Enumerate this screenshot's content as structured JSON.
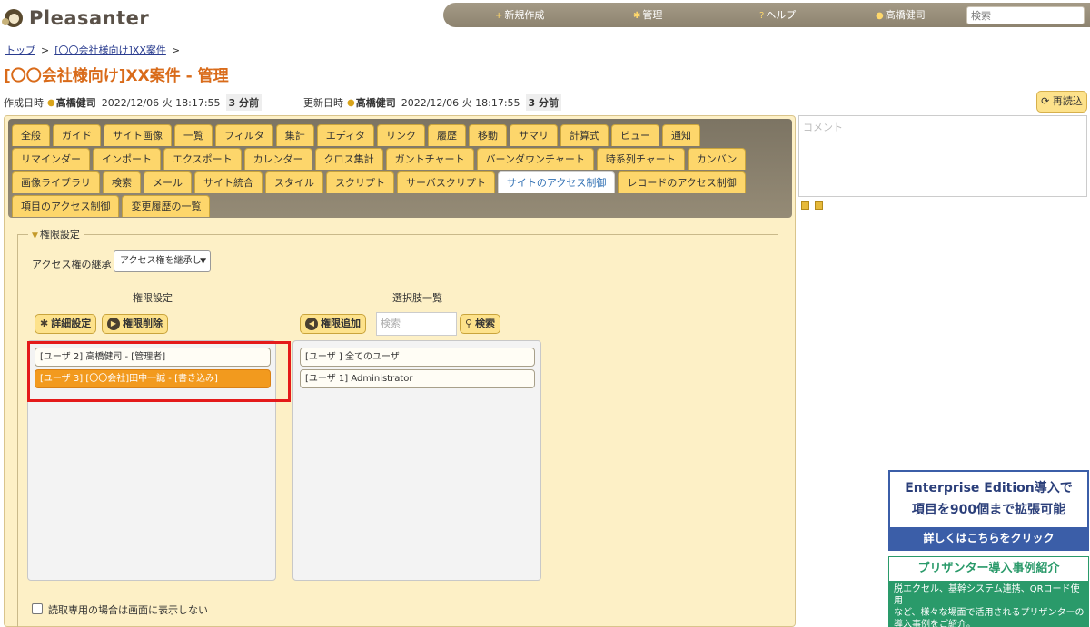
{
  "app": {
    "name": "Pleasanter"
  },
  "topnav": {
    "new_label": "新規作成",
    "manage_label": "管理",
    "help_label": "ヘルプ",
    "user_label": "高橋健司",
    "search_placeholder": "検索"
  },
  "breadcrumb": {
    "home": "トップ",
    "sep1": ">",
    "site": "[〇〇会社様向け]XX案件",
    "sep2": ">"
  },
  "page_title": "[〇〇会社様向け]XX案件 - 管理",
  "meta": {
    "created_label": "作成日時",
    "created_user": "高橋健司",
    "created_time": "2022/12/06 火 18:17:55",
    "created_ago": "3 分前",
    "updated_label": "更新日時",
    "updated_user": "高橋健司",
    "updated_time": "2022/12/06 火 18:17:55",
    "updated_ago": "3 分前"
  },
  "reload_label": "再読込",
  "tabs": {
    "row1": [
      "全般",
      "ガイド",
      "サイト画像",
      "一覧",
      "フィルタ",
      "集計",
      "エディタ",
      "リンク",
      "履歴",
      "移動",
      "サマリ",
      "計算式",
      "ビュー",
      "通知"
    ],
    "row2": [
      "リマインダー",
      "インポート",
      "エクスポート",
      "カレンダー",
      "クロス集計",
      "ガントチャート",
      "バーンダウンチャート",
      "時系列チャート",
      "カンバン"
    ],
    "row3": [
      "画像ライブラリ",
      "検索",
      "メール",
      "サイト統合",
      "スタイル",
      "スクリプト",
      "サーバスクリプト",
      "サイトのアクセス制御",
      "レコードのアクセス制御"
    ],
    "row4": [
      "項目のアクセス制御",
      "変更履歴の一覧"
    ],
    "active": "サイトのアクセス制御"
  },
  "permissions": {
    "legend": "権限設定",
    "inherit_label": "アクセス権の継承",
    "inherit_value": "アクセス権を継承し",
    "left_heading": "権限設定",
    "right_heading": "選択肢一覧",
    "detail_button": "詳細設定",
    "delete_button": "権限削除",
    "add_button": "権限追加",
    "search_placeholder": "検索",
    "search_button": "検索",
    "current": [
      {
        "label": "[ユーザ 2] 高橋健司 - [管理者]",
        "selected": false
      },
      {
        "label": "[ユーザ 3] [〇〇会社]田中一誠 - [書き込み]",
        "selected": true
      }
    ],
    "options": [
      {
        "label": "[ユーザ ] 全てのユーザ"
      },
      {
        "label": "[ユーザ 1] Administrator"
      }
    ],
    "readonly_checkbox_label": "読取専用の場合は画面に表示しない",
    "readonly_checked": false
  },
  "comment_placeholder": "コメント",
  "banner_enterprise": {
    "line1": "Enterprise Edition導入で",
    "line2": "項目を900個まで拡張可能",
    "cta": "詳しくはこちらをクリック",
    "accent": "#3b5ea8"
  },
  "banner_cases": {
    "title": "プリザンター導入事例紹介",
    "line1": "脱エクセル、基幹システム連携、QRコード使用",
    "line2": "など、様々な場面で活用されるプリザンターの",
    "line3": "導入事例をご紹介。",
    "accent": "#2a9a6a"
  }
}
